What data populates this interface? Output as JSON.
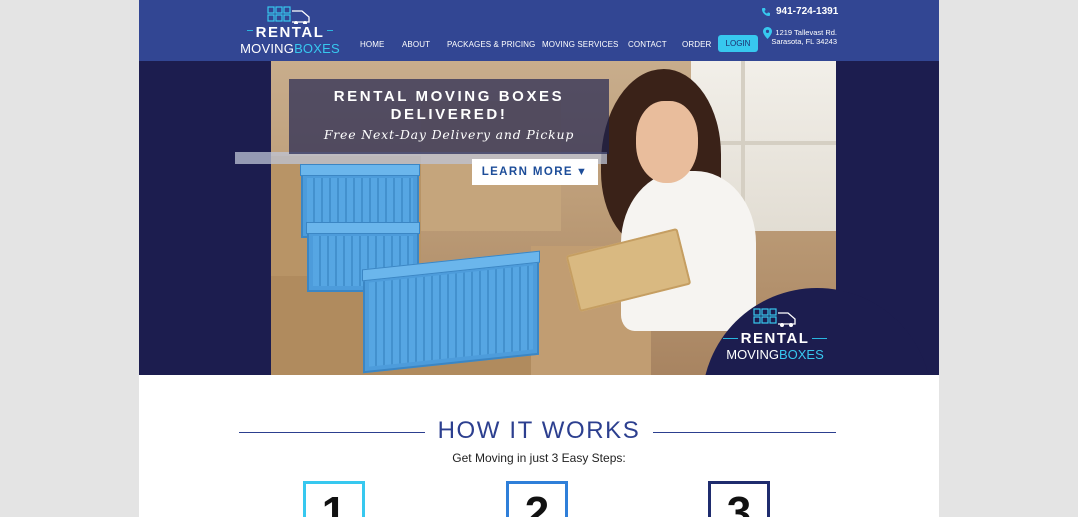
{
  "brand": {
    "logo_line1": "RENTAL",
    "logo_moving": "MOVING",
    "logo_boxes": "BOXES"
  },
  "nav": {
    "items": [
      "HOME",
      "ABOUT",
      "PACKAGES & PRICING",
      "MOVING SERVICES",
      "CONTACT",
      "ORDER"
    ],
    "login": "LOGIN"
  },
  "contact": {
    "phone": "941-724-1391",
    "address_line1": "1219 Tallevast Rd.",
    "address_line2": "Sarasota, FL 34243"
  },
  "hero": {
    "headline_line1": "RENTAL MOVING BOXES",
    "headline_line2": "DELIVERED!",
    "subhead": "Free Next-Day Delivery and Pickup",
    "cta": "LEARN MORE"
  },
  "how": {
    "title": "HOW IT WORKS",
    "subtitle": "Get Moving in just 3 Easy Steps:",
    "steps": [
      "1",
      "2",
      "3"
    ]
  },
  "colors": {
    "header_bg": "#324693",
    "hero_bg": "#1c1d4f",
    "accent_cyan": "#37c8ef",
    "step1_border": "#37c8ef",
    "step2_border": "#2f7fd9",
    "step3_border": "#1f2c6e"
  },
  "icons": {
    "phone": "phone-icon",
    "pin": "map-pin-icon",
    "truck": "truck-icon",
    "cta_arrow": "triangle-down-icon"
  }
}
